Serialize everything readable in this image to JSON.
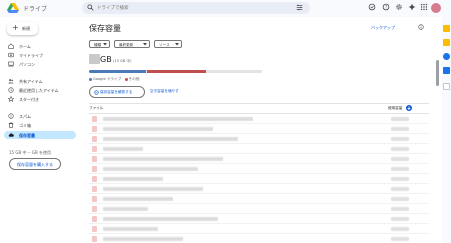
{
  "app": {
    "title": "ドライブ",
    "logo_icon": "google-drive-icon"
  },
  "search": {
    "placeholder": "ドライブで検索"
  },
  "colors": {
    "accent": "#0b57d0",
    "nav_active_bg": "#c2e7ff",
    "bar_drive": "#4a7bb7",
    "bar_other": "#c0504d"
  },
  "new_button": {
    "label": "新規"
  },
  "sidebar": {
    "items": [
      {
        "label": "ホーム",
        "icon": "home-icon"
      },
      {
        "label": "マイドライブ",
        "icon": "my-drive-icon"
      },
      {
        "label": "パソコン",
        "icon": "computer-icon"
      },
      {
        "label": "共有アイテム",
        "icon": "shared-icon"
      },
      {
        "label": "最近使用したアイテム",
        "icon": "clock-icon"
      },
      {
        "label": "スター付き",
        "icon": "star-icon"
      },
      {
        "label": "スパム",
        "icon": "spam-icon"
      },
      {
        "label": "ゴミ箱",
        "icon": "trash-icon"
      },
      {
        "label": "保存容量",
        "icon": "cloud-icon"
      }
    ],
    "usage_text": "15 GB 中 -- GB を使用",
    "buy_button": "保存容量を購入する"
  },
  "main": {
    "title": "保存容量",
    "backup_link": "バックアップ",
    "filters": [
      "種類",
      "最終更新",
      "ソース"
    ],
    "storage": {
      "unit": "GB",
      "subtext": "(15 GB 中)",
      "drive_fraction": 0.33,
      "other_fraction": 0.34,
      "legend": [
        "Google ドライブ",
        "その他"
      ]
    },
    "clean_button": "保存容量を解放する",
    "review_link": "空き容量を増やす",
    "table": {
      "col_file": "ファイル",
      "col_used": "使用容量",
      "rows": 13
    }
  }
}
